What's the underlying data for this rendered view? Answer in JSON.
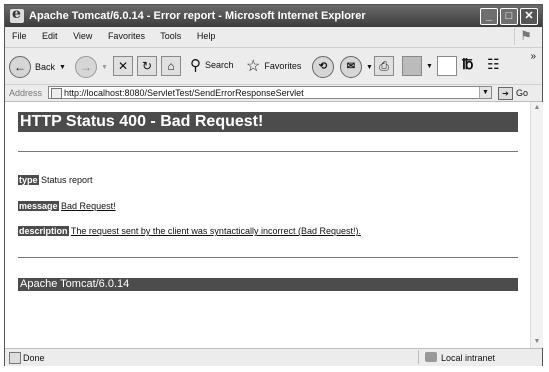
{
  "window": {
    "title": "Apache Tomcat/6.0.14 - Error report - Microsoft Internet Explorer",
    "controls": {
      "minimize": "_",
      "maximize": "□",
      "close": "✕"
    }
  },
  "menubar": {
    "items": [
      "File",
      "Edit",
      "View",
      "Favorites",
      "Tools",
      "Help"
    ]
  },
  "toolbar": {
    "back_label": "Back",
    "search_label": "Search",
    "favorites_label": "Favorites",
    "icons": [
      "back-icon",
      "forward-icon",
      "stop-icon",
      "refresh-icon",
      "home-icon",
      "search-icon",
      "favorites-star-icon",
      "history-icon",
      "mail-icon",
      "print-icon",
      "edit-icon",
      "discuss-icon",
      "messenger-icon",
      "research-icon"
    ],
    "chevron": "»"
  },
  "address": {
    "label": "Address",
    "url": "http://localhost:8080/ServletTest/SendErrorResponseServlet",
    "go_label": "Go"
  },
  "page": {
    "heading": "HTTP Status 400 - Bad Request!",
    "type_label": "type",
    "type_value": "Status report",
    "message_label": "message",
    "message_value": "Bad Request!",
    "description_label": "description",
    "description_value": "The request sent by the client was syntactically incorrect (Bad Request!).",
    "footer": "Apache Tomcat/6.0.14"
  },
  "statusbar": {
    "status": "Done",
    "zone": "Local intranet"
  },
  "colors": {
    "title_bar": "#4a4a4a",
    "heading_bg": "#4c4c4c",
    "chrome_bg": "#ececec"
  }
}
